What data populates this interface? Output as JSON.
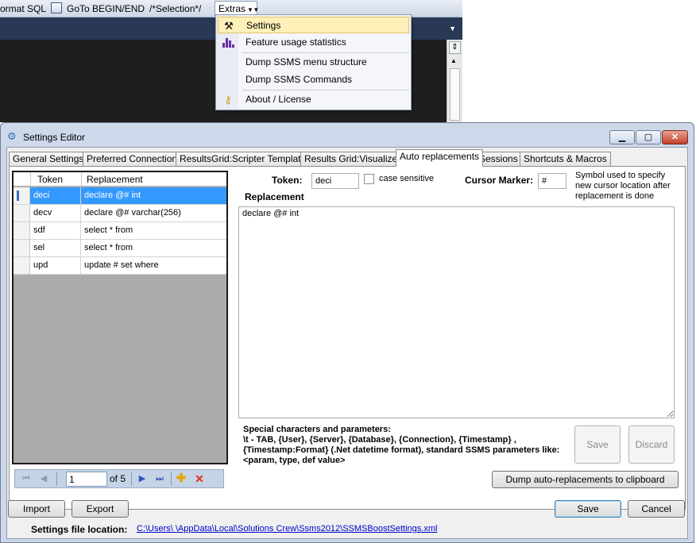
{
  "toolbar": {
    "format_sql": "ormat SQL",
    "goto_label": "GoTo BEGIN/END",
    "selection_label": "/*Selection*/",
    "extras_label": "Extras",
    "extras_menu": [
      {
        "label": "Settings",
        "icon": "tools-icon"
      },
      {
        "label": "Feature usage statistics",
        "icon": "bar-chart-icon"
      },
      {
        "label": "Dump SSMS menu structure"
      },
      {
        "label": "Dump SSMS Commands"
      },
      {
        "label": "About / License",
        "icon": "key-icon"
      }
    ]
  },
  "window": {
    "title": "Settings Editor",
    "tabs": [
      "General Settings",
      "Preferred Connections",
      "ResultsGrid:Scripter Templates",
      "Results Grid:Visualizers",
      "Auto replacements",
      "Sessions",
      "Shortcuts & Macros"
    ],
    "active_tab": "Auto replacements"
  },
  "grid": {
    "columns": [
      "Token",
      "Replacement"
    ],
    "rows": [
      {
        "token": "deci",
        "replacement": "declare @# int",
        "selected": true
      },
      {
        "token": "decv",
        "replacement": "declare @# varchar(256)"
      },
      {
        "token": "sdf",
        "replacement": "select * from"
      },
      {
        "token": "sel",
        "replacement": "select * from"
      },
      {
        "token": "upd",
        "replacement": "update # set where"
      }
    ],
    "navigator": {
      "position": "1",
      "of_label": "of 5"
    }
  },
  "editor": {
    "token_label": "Token:",
    "token_value": "deci",
    "case_sensitive_label": "case sensitive",
    "case_sensitive_checked": false,
    "cursor_marker_label": "Cursor Marker:",
    "cursor_marker_value": "#",
    "symbol_help": "Symbol used to specify new cursor location after replacement is done",
    "replacement_label": "Replacement",
    "replacement_text": "declare @# int",
    "special_chars_text": "Special characters and parameters:\n\\t - TAB, {User}, {Server}, {Database}, {Connection}, {Timestamp} , {Timestamp:Format} (.Net datetime format), standard SSMS parameters like: <param, type, def value>",
    "save_label": "Save",
    "discard_label": "Discard",
    "dump_label": "Dump auto-replacements to clipboard"
  },
  "footer": {
    "import_label": "Import",
    "export_label": "Export",
    "save_label": "Save",
    "cancel_label": "Cancel",
    "location_label": "Settings file location:",
    "location_path": "C:\\Users\\                \\AppData\\Local\\Solutions Crew\\Ssms2012\\SSMSBoostSettings.xml"
  }
}
